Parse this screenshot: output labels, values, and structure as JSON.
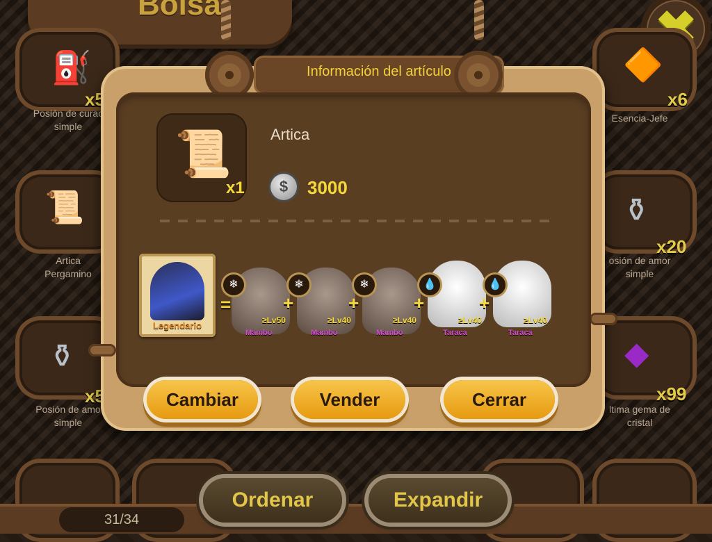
{
  "title": "Bolsa",
  "close_icon": "close-x-icon",
  "inventory": {
    "left": [
      {
        "name": "Posión de curación simple",
        "label": "Posión de curac\nsimple",
        "count": "x5",
        "icon": "potion-lantern-icon"
      },
      {
        "name": "Artica Pergamino",
        "label": "Artica\nPergamino",
        "count": "",
        "icon": "scroll-icon"
      },
      {
        "name": "Posión de amor simple",
        "label": "Posión de amo\nsimple",
        "count": "x5",
        "icon": "anvil-potion-icon"
      }
    ],
    "right": [
      {
        "name": "Esencia-Jefe",
        "label": "Esencia-Jefe",
        "count": "x6",
        "icon": "essence-icon"
      },
      {
        "name": "Posión de amor simple",
        "label": "osión de amor\nsimple",
        "count": "x20",
        "icon": "anvil-potion-icon"
      },
      {
        "name": "Última gema de cristal",
        "label": "ltima gema de\ncristal",
        "count": "x99",
        "icon": "purple-gem-icon"
      }
    ]
  },
  "modal": {
    "header": "Información del artículo",
    "item": {
      "name": "Artica",
      "quantity": "x1",
      "price": "3000",
      "icon": "scroll-icon",
      "currency_icon": "silver-coin-icon"
    },
    "recipe": {
      "result_label": "Legendario",
      "equals": "=",
      "plus": "+",
      "ingredients": [
        {
          "name": "Mambo",
          "level": "≥Lv50",
          "element": "snowflake",
          "color": "#8c8078"
        },
        {
          "name": "Mambo",
          "level": "≥Lv40",
          "element": "snowflake",
          "color": "#8c8078"
        },
        {
          "name": "Mambo",
          "level": "≥Lv40",
          "element": "snowflake",
          "color": "#8c8078"
        },
        {
          "name": "Taraca",
          "level": "≥Lv40",
          "element": "water",
          "color": "#e8e8e8"
        },
        {
          "name": "Taraca",
          "level": "≥Lv40",
          "element": "water",
          "color": "#e8e8e8"
        }
      ]
    },
    "buttons": {
      "change": "Cambiar",
      "sell": "Vender",
      "close": "Cerrar"
    }
  },
  "bottom": {
    "sort": "Ordenar",
    "expand": "Expandir",
    "counter": "31/34"
  },
  "colors": {
    "accent_gold": "#f5d83a",
    "button_orange": "#e79a10",
    "wood_dark": "#5a3e22",
    "legendary_orange": "#e08a28",
    "monster_name_magenta": "#d44ad0"
  }
}
